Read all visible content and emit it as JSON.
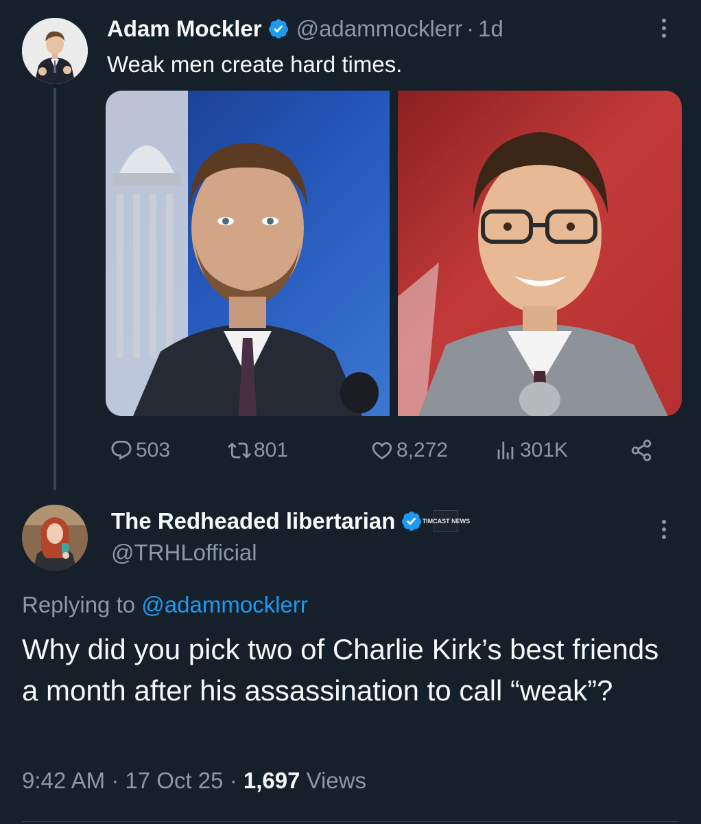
{
  "colors": {
    "background": "#15202b",
    "primary_text": "#f7f9f9",
    "secondary_text": "#8b98a5",
    "accent_link": "#1d9bf0",
    "verified_badge": "#1d9bf0",
    "thread_line": "#38444d"
  },
  "tweet": {
    "author": {
      "display_name": "Adam Mockler",
      "handle": "@adammocklerr",
      "verified": true
    },
    "separator": "·",
    "time_ago": "1d",
    "text": "Weak men create hard times.",
    "media_count": 2,
    "actions": {
      "replies": "503",
      "retweets": "801",
      "likes": "8,272",
      "views": "301K"
    }
  },
  "reply": {
    "author": {
      "display_name": "The Redheaded libertarian",
      "handle": "@TRHLofficial",
      "verified": true,
      "affiliate_badge": "TIMCAST NEWS"
    },
    "replying_prefix": "Replying to",
    "replying_to": "@adammocklerr",
    "text": "Why did you pick two of Charlie Kirk’s best friends a month after his assassination to call “weak”?",
    "time": "9:42 AM",
    "date": "17 Oct 25",
    "views_count": "1,697",
    "views_label": "Views"
  },
  "icons": {
    "reply": "speech-bubble-icon",
    "retweet": "retweet-arrows-icon",
    "like": "heart-icon",
    "views": "bar-chart-icon",
    "share": "share-nodes-icon",
    "more": "vertical-ellipsis-icon",
    "verified": "verified-check-icon"
  }
}
